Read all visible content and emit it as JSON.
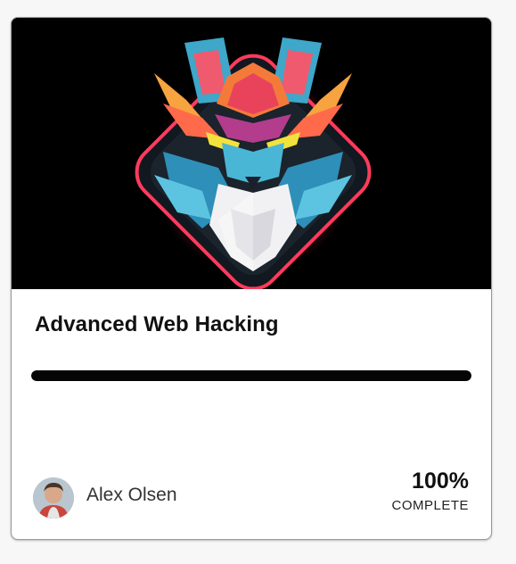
{
  "course": {
    "title": "Advanced Web Hacking",
    "progress_fraction": 1.0,
    "progress_percent_label": "100%",
    "progress_status_label": "COMPLETE",
    "banner_image": "fox-mascot-logo"
  },
  "author": {
    "name": "Alex Olsen",
    "avatar": "author-avatar-photo"
  },
  "colors": {
    "banner_background": "#000000",
    "progress_fill": "#050505",
    "card_background": "#ffffff",
    "glow": "#ff2d55"
  }
}
